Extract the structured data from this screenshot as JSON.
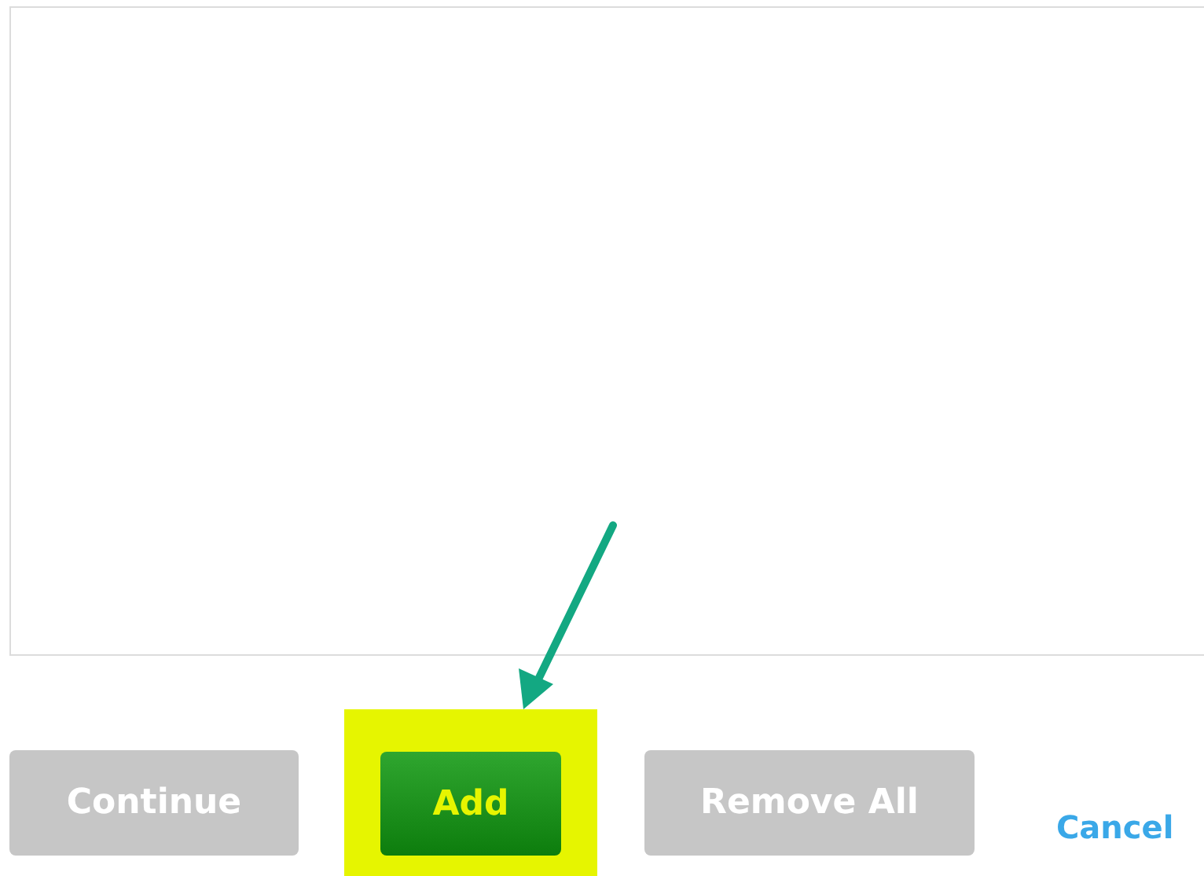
{
  "buttons": [
    {
      "kind": "gray",
      "label": "Continue",
      "highlighted": false
    },
    {
      "kind": "green",
      "label": "Add",
      "highlighted": true
    },
    {
      "kind": "gray",
      "label": "Remove All",
      "highlighted": false
    },
    {
      "kind": "link",
      "label": "Cancel",
      "highlighted": false
    }
  ]
}
